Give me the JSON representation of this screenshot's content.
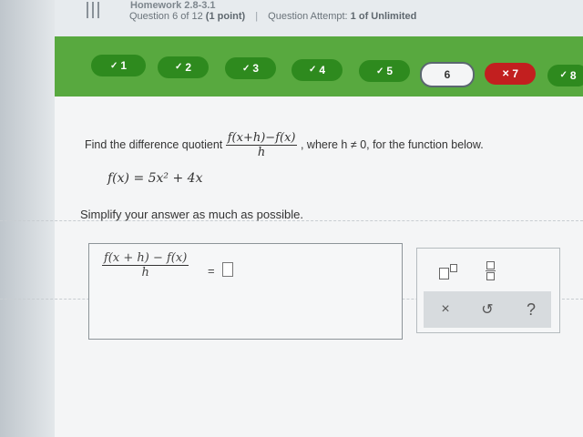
{
  "header": {
    "title": "Homework 2.8-3.1",
    "question_info": "Question 6 of 12",
    "points": "(1 point)",
    "attempt_label": "Question Attempt:",
    "attempt_value": "1 of Unlimited"
  },
  "question_nav": [
    {
      "label": "1",
      "status": "correct",
      "mark": "✓"
    },
    {
      "label": "2",
      "status": "correct",
      "mark": "✓"
    },
    {
      "label": "3",
      "status": "correct",
      "mark": "✓"
    },
    {
      "label": "4",
      "status": "correct",
      "mark": "✓"
    },
    {
      "label": "5",
      "status": "correct",
      "mark": "✓"
    },
    {
      "label": "6",
      "status": "current",
      "mark": ""
    },
    {
      "label": "7",
      "status": "incorrect",
      "mark": "✕"
    },
    {
      "label": "8",
      "status": "correct",
      "mark": "✓"
    }
  ],
  "problem": {
    "prefix": "Find the difference quotient",
    "dq_numerator": "f(x+h)−f(x)",
    "dq_denominator": "h",
    "suffix": ", where h ≠ 0, for the function below.",
    "function": "f(x) = 5x² + 4x",
    "instruction": "Simplify your answer as much as possible."
  },
  "answer": {
    "numerator": "f(x + h) − f(x)",
    "denominator": "h",
    "equals": "="
  },
  "palette": {
    "clear": "×",
    "undo": "↺",
    "help": "?"
  },
  "colors": {
    "nav_bar": "#58a93f",
    "correct": "#2e8a1e",
    "incorrect": "#c21f1f"
  }
}
